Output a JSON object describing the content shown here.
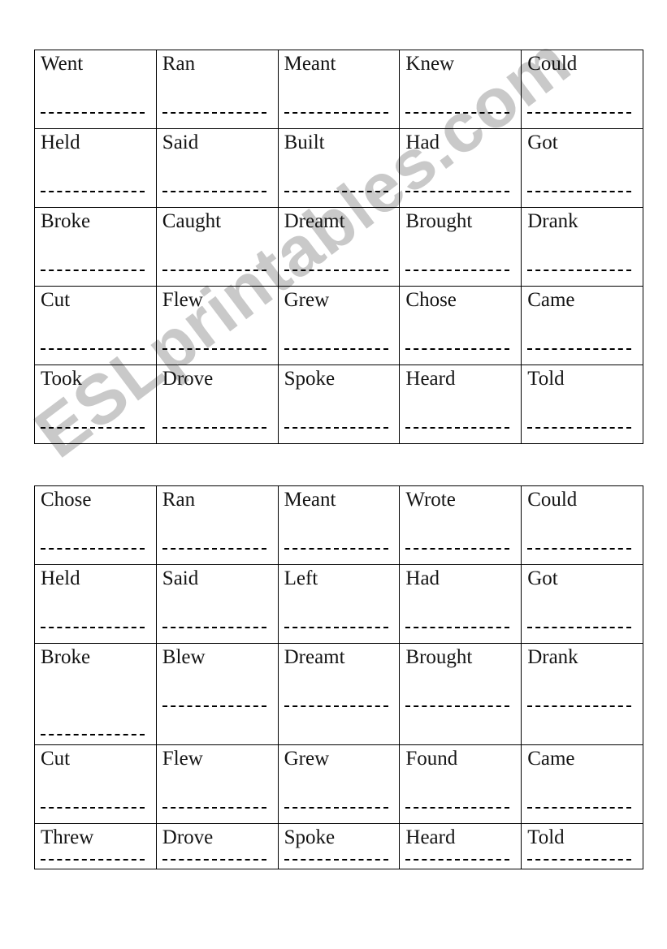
{
  "document": {
    "type": "irregular-verbs-worksheet",
    "watermark": "ESLprintables.com",
    "watermark_color": "#c9c9c9",
    "ink_color": "#141414",
    "border_color": "#000000"
  },
  "tables": [
    {
      "name": "verb-grid-1",
      "rows": [
        {
          "height": "standard",
          "cells": [
            {
              "verb": "Went",
              "blank": "standard"
            },
            {
              "verb": "Ran",
              "blank": "standard"
            },
            {
              "verb": "Meant",
              "blank": "standard"
            },
            {
              "verb": "Knew",
              "blank": "standard"
            },
            {
              "verb": "Could",
              "blank": "standard"
            }
          ]
        },
        {
          "height": "standard",
          "cells": [
            {
              "verb": "Held",
              "blank": "standard"
            },
            {
              "verb": "Said",
              "blank": "standard"
            },
            {
              "verb": "Built",
              "blank": "standard"
            },
            {
              "verb": "Had",
              "blank": "standard"
            },
            {
              "verb": "Got",
              "blank": "standard"
            }
          ]
        },
        {
          "height": "standard",
          "cells": [
            {
              "verb": "Broke",
              "blank": "standard"
            },
            {
              "verb": "Caught",
              "blank": "standard"
            },
            {
              "verb": "Dreamt",
              "blank": "standard"
            },
            {
              "verb": "Brought",
              "blank": "standard"
            },
            {
              "verb": "Drank",
              "blank": "standard"
            }
          ]
        },
        {
          "height": "standard",
          "cells": [
            {
              "verb": "Cut",
              "blank": "standard"
            },
            {
              "verb": "Flew",
              "blank": "standard"
            },
            {
              "verb": "Grew",
              "blank": "standard"
            },
            {
              "verb": "Chose",
              "blank": "standard"
            },
            {
              "verb": "Came",
              "blank": "standard"
            }
          ]
        },
        {
          "height": "standard",
          "cells": [
            {
              "verb": "Took",
              "blank": "standard"
            },
            {
              "verb": "Drove",
              "blank": "standard"
            },
            {
              "verb": "Spoke",
              "blank": "standard"
            },
            {
              "verb": "Heard",
              "blank": "standard"
            },
            {
              "verb": "Told",
              "blank": "standard"
            }
          ]
        }
      ]
    },
    {
      "name": "verb-grid-2",
      "rows": [
        {
          "height": "standard",
          "cells": [
            {
              "verb": "Chose",
              "blank": "standard"
            },
            {
              "verb": "Ran",
              "blank": "standard"
            },
            {
              "verb": "Meant",
              "blank": "standard"
            },
            {
              "verb": "Wrote",
              "blank": "standard"
            },
            {
              "verb": "Could",
              "blank": "standard"
            }
          ]
        },
        {
          "height": "standard",
          "cells": [
            {
              "verb": "Held",
              "blank": "standard"
            },
            {
              "verb": "Said",
              "blank": "standard"
            },
            {
              "verb": "Left",
              "blank": "standard"
            },
            {
              "verb": "Had",
              "blank": "standard"
            },
            {
              "verb": "Got",
              "blank": "standard"
            }
          ]
        },
        {
          "height": "tall",
          "cells": [
            {
              "verb": "Broke",
              "blank": "low"
            },
            {
              "verb": "Blew",
              "blank": "standard"
            },
            {
              "verb": "Dreamt",
              "blank": "standard"
            },
            {
              "verb": "Brought",
              "blank": "standard"
            },
            {
              "verb": "Drank",
              "blank": "standard"
            }
          ]
        },
        {
          "height": "standard",
          "cells": [
            {
              "verb": "Cut",
              "blank": "standard"
            },
            {
              "verb": "Flew",
              "blank": "standard"
            },
            {
              "verb": "Grew",
              "blank": "standard"
            },
            {
              "verb": "Found",
              "blank": "standard"
            },
            {
              "verb": "Came",
              "blank": "standard"
            }
          ]
        },
        {
          "height": "short",
          "cells": [
            {
              "verb": "Threw",
              "blank": "standard"
            },
            {
              "verb": "Drove",
              "blank": "standard"
            },
            {
              "verb": "Spoke",
              "blank": "standard"
            },
            {
              "verb": "Heard",
              "blank": "standard"
            },
            {
              "verb": "Told",
              "blank": "standard"
            }
          ]
        }
      ]
    }
  ]
}
